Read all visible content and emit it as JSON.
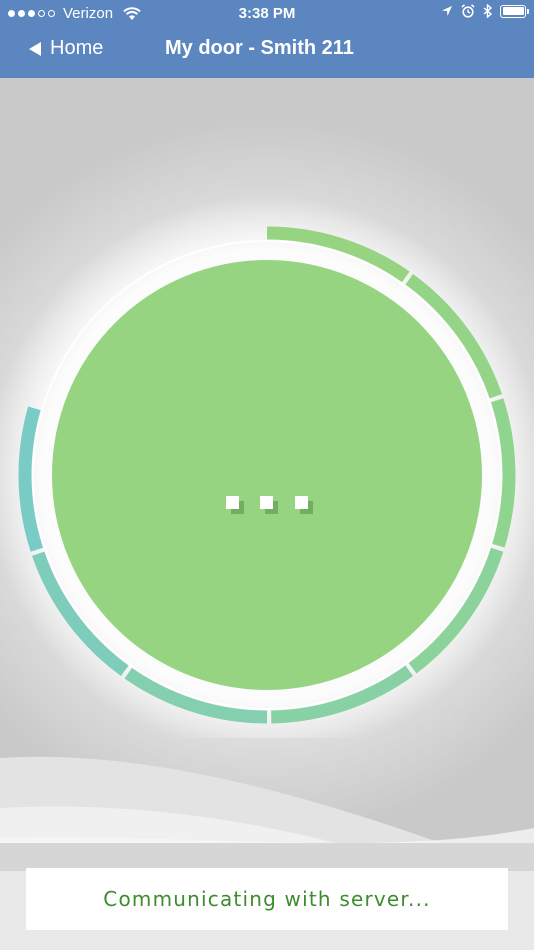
{
  "status_bar": {
    "carrier": "Verizon",
    "time": "3:38 PM",
    "signal_bars_filled": 3,
    "signal_bars_total": 5,
    "battery_level": 1.0
  },
  "nav": {
    "back_label": "Home",
    "title": "My door - Smith 211"
  },
  "dial": {
    "center_icon": "three-dots-icon",
    "center_color": "#96d481",
    "ring_gradient": [
      "#96d481",
      "#7cc9c4"
    ]
  },
  "status": {
    "message": "Communicating with server..."
  },
  "colors": {
    "header": "#5b86bf",
    "status_text": "#3d8c2e"
  }
}
